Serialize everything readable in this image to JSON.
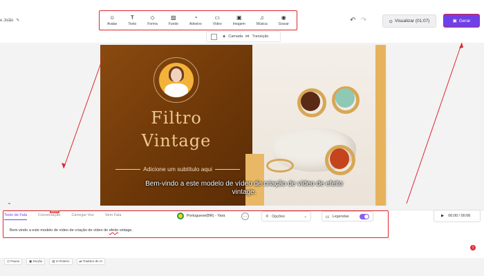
{
  "project": {
    "title": "e Joião",
    "edit_icon": "pencil-icon"
  },
  "tools": [
    {
      "label": "Avatar",
      "icon": "☺"
    },
    {
      "label": "Texto",
      "icon": "Ŧ"
    },
    {
      "label": "Forma",
      "icon": "◇"
    },
    {
      "label": "Fundo",
      "icon": "▨"
    },
    {
      "label": "Adesivo",
      "icon": "◔"
    },
    {
      "label": "Vídeo",
      "icon": "▭"
    },
    {
      "label": "Imagem",
      "icon": "▣"
    },
    {
      "label": "Música",
      "icon": "♫"
    },
    {
      "label": "Gravar",
      "icon": "◉"
    }
  ],
  "header": {
    "undo": "↶",
    "redo": "↷",
    "preview_label": "Visualizar (01:07)",
    "generate_label": "Gerar"
  },
  "subbar": {
    "layer_label": "Camada",
    "transition_label": "Transição"
  },
  "slide": {
    "title_line1": "Filtro",
    "title_line2": "Vintage",
    "subtitle": "Adicione um subtítulo aqui",
    "caption": "Bem-vindo a este modelo de vídeo de criação de vídeo de efeito vintage."
  },
  "speech": {
    "tabs": [
      "Texto de Fala",
      "Conversação",
      "Carregar Voz",
      "Sem Fala"
    ],
    "new_badge": "NOVO",
    "voice": "Portuguese(BR) - Yara",
    "options_label": "Opções",
    "subtitles_label": "Legendas",
    "time": "00:00 / 00:06",
    "text_before": "Bem-vindo a este modelo de vídeo de criação de vídeo de ",
    "text_underlined": "efeito",
    "text_after": " vintage."
  },
  "notification_count": "1",
  "bottom_actions": [
    "Pausa",
    "Dicção",
    "IA Roteiro",
    "Tradutor de IA"
  ],
  "colors": {
    "accent": "#6f3fe8",
    "highlight": "#e0242a",
    "brown": "#7a4010",
    "gold": "#e6b35c"
  }
}
